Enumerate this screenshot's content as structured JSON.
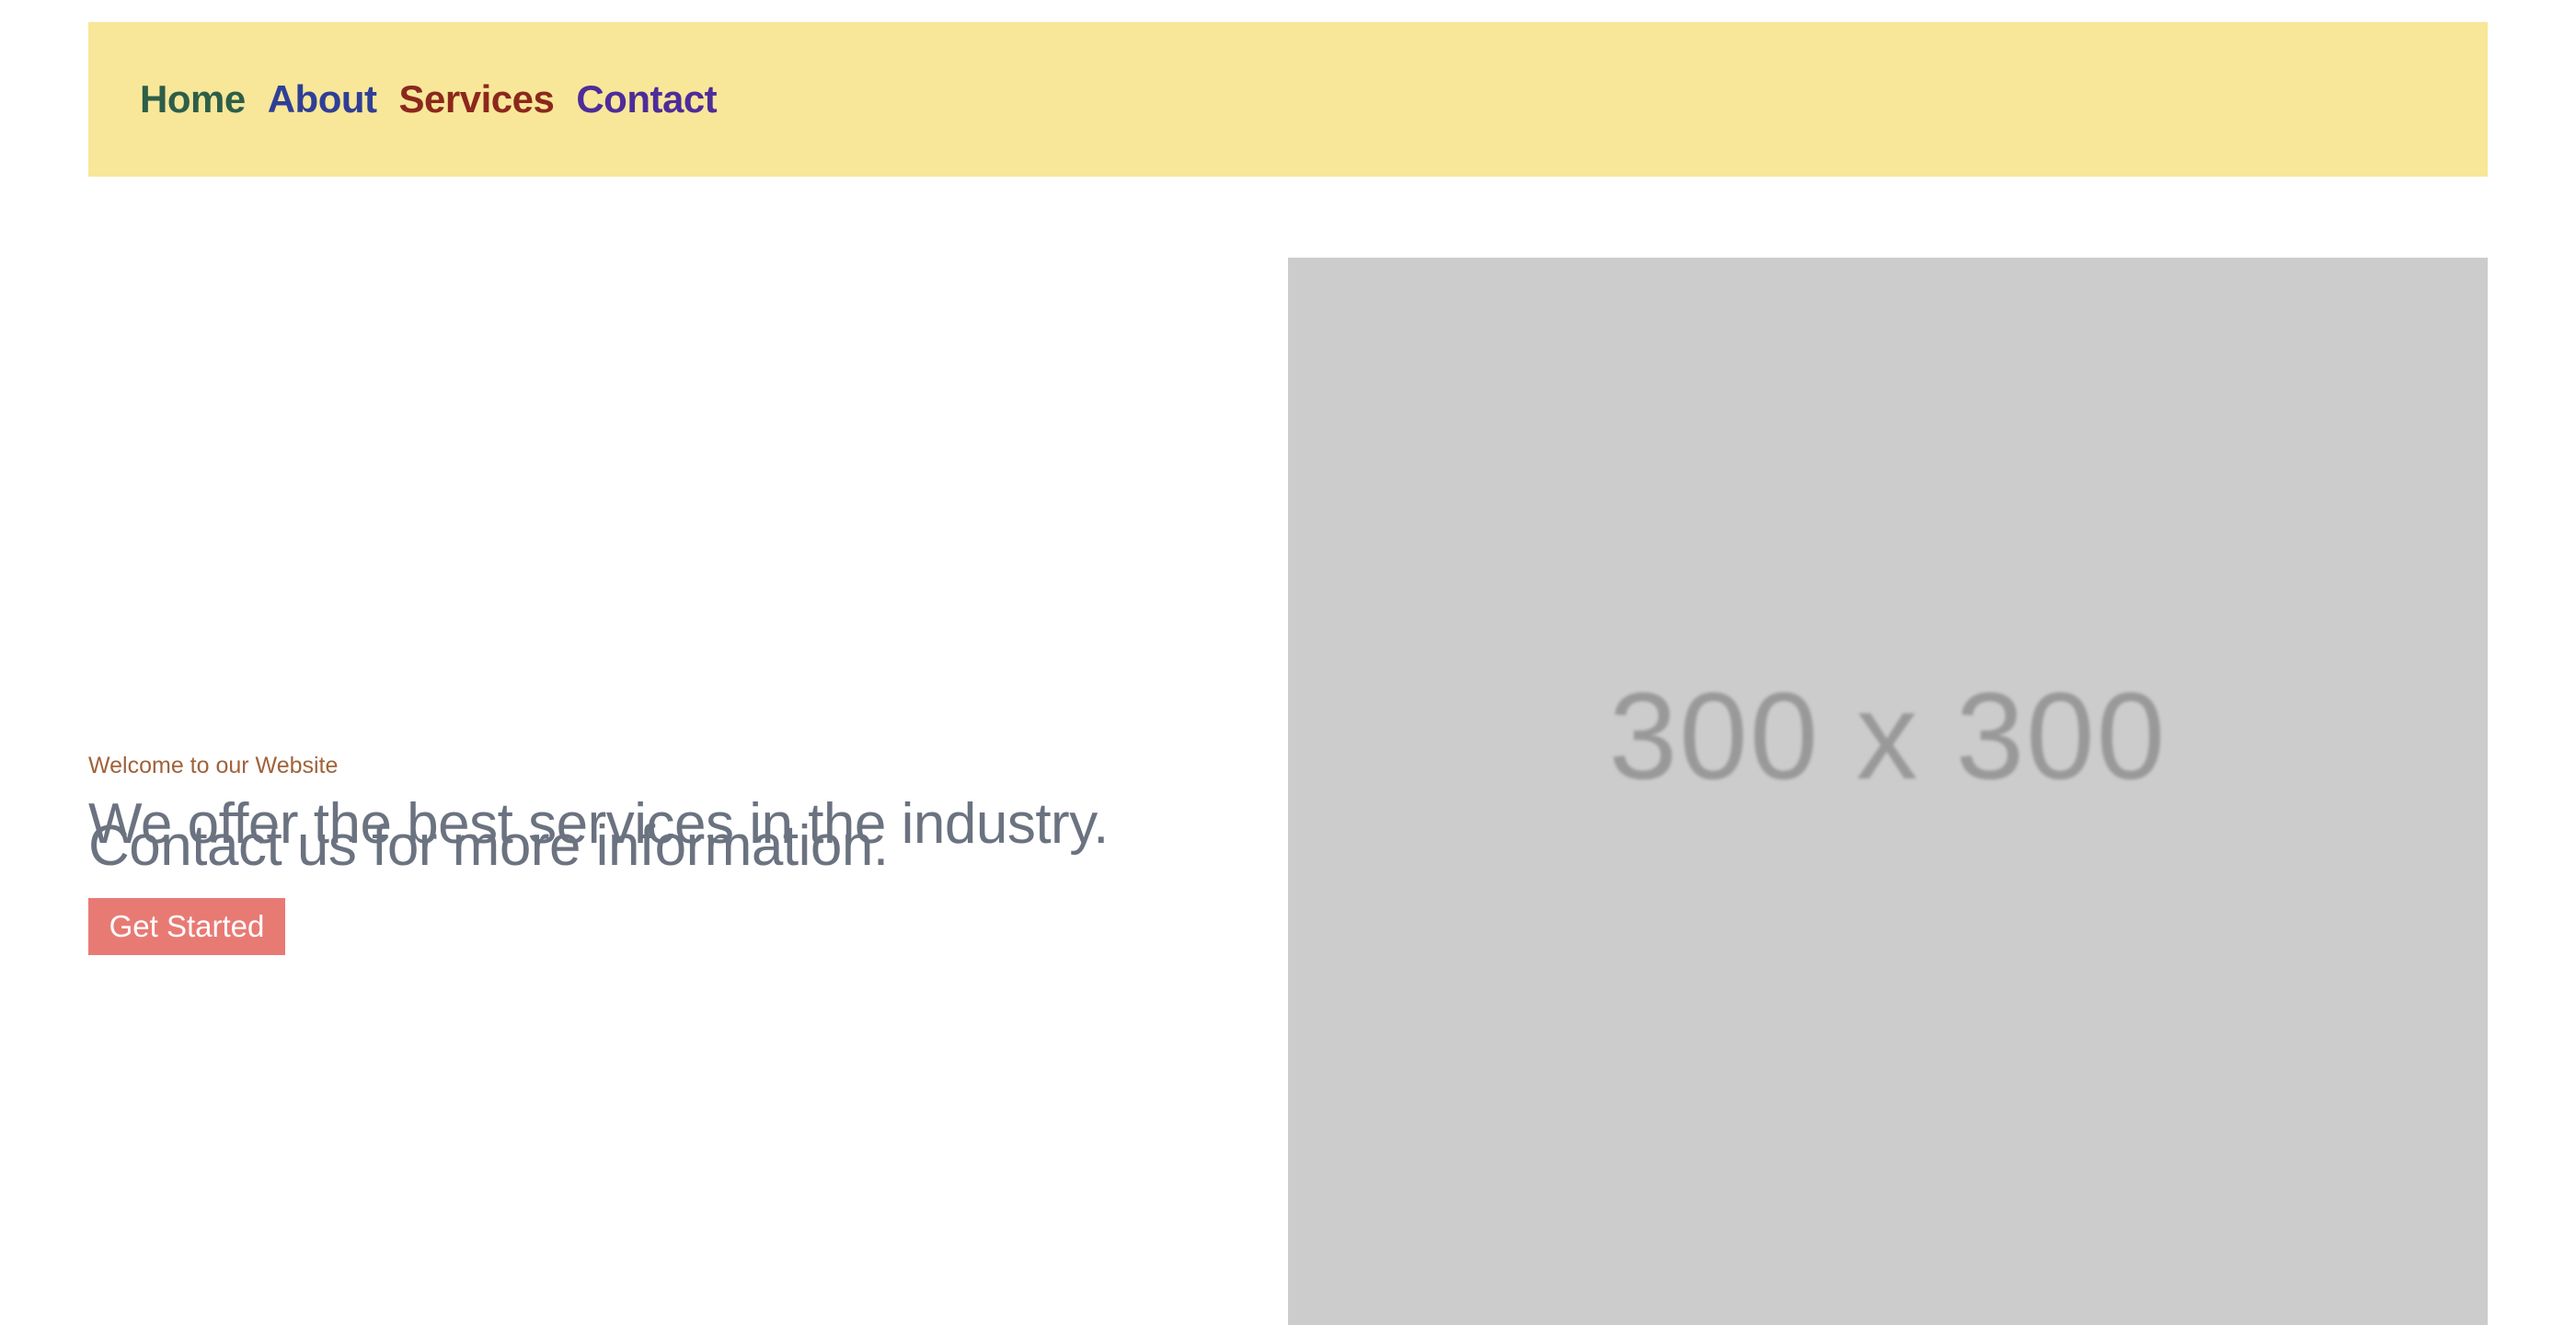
{
  "nav": {
    "items": [
      {
        "label": "Home",
        "color": "#2d5e49"
      },
      {
        "label": "About",
        "color": "#2f3f96"
      },
      {
        "label": "Services",
        "color": "#8c271c"
      },
      {
        "label": "Contact",
        "color": "#4e2c99"
      }
    ],
    "background": "#f8e799"
  },
  "hero": {
    "eyebrow": "Welcome to our Website",
    "headline": "We offer the best services in the industry. Contact us for more information.",
    "cta_label": "Get Started",
    "cta_color": "#e87a74",
    "image_label": "300 x 300"
  }
}
